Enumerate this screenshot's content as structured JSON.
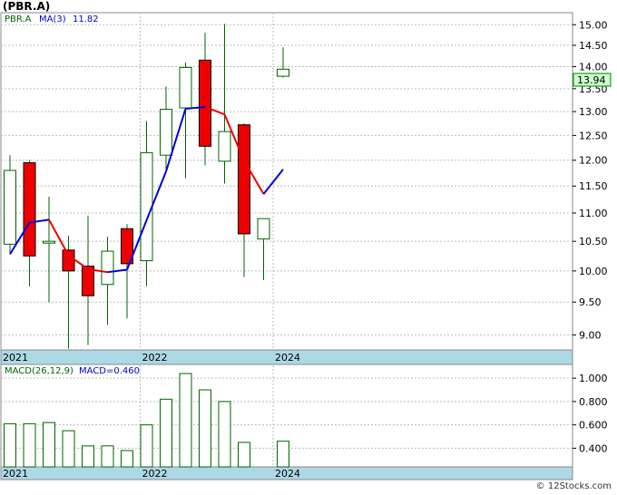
{
  "header": {
    "title": "(PBR.A)"
  },
  "footer": {
    "credit": "© 12Stocks.com"
  },
  "colors": {
    "up_candle": "#ffffff",
    "up_border": "#006400",
    "down_candle": "#ee0000",
    "wick": "#006400",
    "ma_up": "#0000dd",
    "ma_down": "#ee0000",
    "axis_band": "#add8e6",
    "grid": "#bbbbbb",
    "last_price_bg": "#ccffcc",
    "macd_bar": "#006400",
    "ticker_green": "#006400",
    "ma_label_blue": "#0000cc"
  },
  "chart_data": [
    {
      "type": "candlestick",
      "panel": "price",
      "legend": {
        "ticker": "PBR.A",
        "ma_label": "MA(3)",
        "ma_value": "11.82"
      },
      "last_price_label": "13.94",
      "ylim": [
        8.78,
        15.3
      ],
      "y_scale": "log",
      "y_ticks": [
        "15.00",
        "14.50",
        "14.00",
        "13.50",
        "13.00",
        "12.50",
        "12.00",
        "11.50",
        "11.00",
        "10.50",
        "10.00",
        "9.50",
        "9.00"
      ],
      "x_labels": [
        "2021",
        "2022",
        "2024"
      ],
      "candles": [
        {
          "o": 10.45,
          "h": 12.1,
          "l": 10.3,
          "c": 11.8
        },
        {
          "o": 11.95,
          "h": 12.0,
          "l": 9.75,
          "c": 10.25
        },
        {
          "o": 10.48,
          "h": 11.3,
          "l": 9.5,
          "c": 10.5
        },
        {
          "o": 10.35,
          "h": 10.6,
          "l": 8.8,
          "c": 10.0
        },
        {
          "o": 10.08,
          "h": 10.95,
          "l": 8.85,
          "c": 9.6
        },
        {
          "o": 9.78,
          "h": 10.58,
          "l": 9.15,
          "c": 10.33
        },
        {
          "o": 10.72,
          "h": 10.8,
          "l": 9.25,
          "c": 10.12
        },
        {
          "o": 10.17,
          "h": 12.8,
          "l": 9.75,
          "c": 12.15
        },
        {
          "o": 12.1,
          "h": 13.55,
          "l": 11.8,
          "c": 13.05
        },
        {
          "o": 13.08,
          "h": 14.1,
          "l": 11.65,
          "c": 13.98
        },
        {
          "o": 14.15,
          "h": 14.8,
          "l": 11.9,
          "c": 12.28
        },
        {
          "o": 11.98,
          "h": 15.02,
          "l": 11.55,
          "c": 12.58
        },
        {
          "o": 12.72,
          "h": 12.75,
          "l": 9.9,
          "c": 10.63
        },
        {
          "o": 10.54,
          "h": 10.9,
          "l": 9.85,
          "c": 10.9
        },
        {
          "o": 13.78,
          "h": 14.45,
          "l": 13.75,
          "c": 13.94
        }
      ],
      "ma": [
        10.28,
        10.83,
        10.88,
        10.26,
        10.03,
        9.98,
        10.02,
        10.87,
        11.78,
        13.06,
        13.1,
        12.94,
        11.99,
        11.35,
        11.82
      ]
    },
    {
      "type": "bar",
      "panel": "macd",
      "legend": {
        "label": "MACD(26,12,9)",
        "value_label": "MACD=0.460"
      },
      "ylim": [
        0.24,
        1.11
      ],
      "y_ticks": [
        "1.000",
        "0.800",
        "0.600",
        "0.400"
      ],
      "x_labels": [
        "2021",
        "2022",
        "2024"
      ],
      "values": [
        0.61,
        0.61,
        0.62,
        0.55,
        0.42,
        0.42,
        0.38,
        0.6,
        0.82,
        1.04,
        0.9,
        0.8,
        0.45,
        null,
        0.46
      ]
    }
  ]
}
